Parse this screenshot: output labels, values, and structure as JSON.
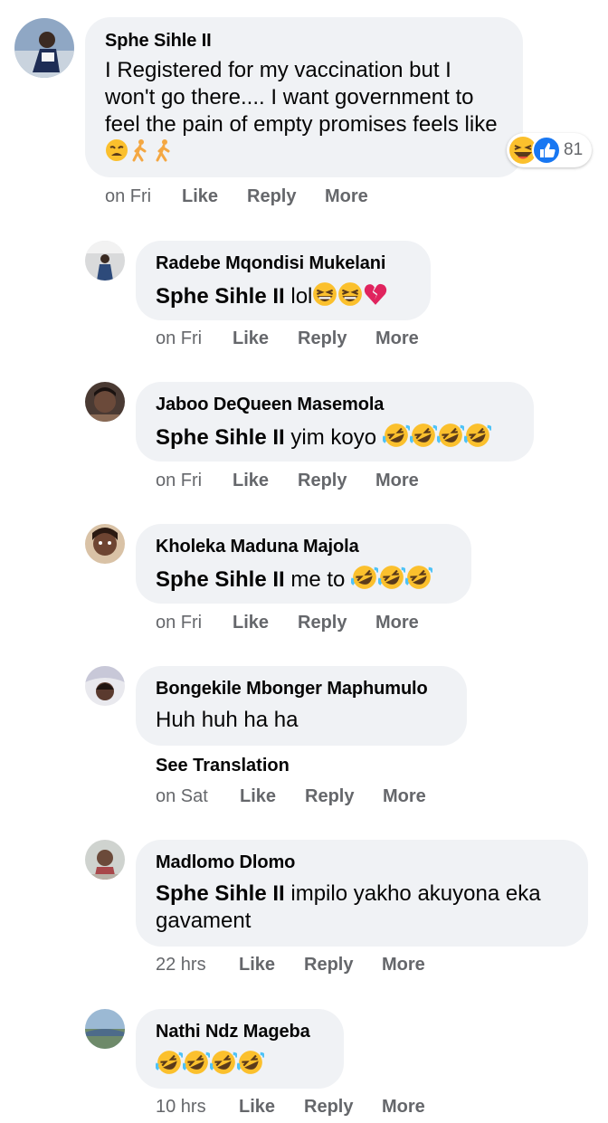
{
  "comments": [
    {
      "author": "Sphe Sihle II",
      "text": "I Registered for my vaccination but I won't go there.... I want government to feel the pain of empty promises feels like",
      "emoji_names": [
        "weary-face-icon",
        "person-walking-icon",
        "person-walking-icon"
      ],
      "reactions": {
        "count": "81",
        "icons": [
          "haha-reaction-icon",
          "like-reaction-icon"
        ]
      },
      "time": "on Fri",
      "like": "Like",
      "reply": "Reply",
      "more": "More"
    },
    {
      "author": "Radebe Mqondisi Mukelani",
      "mention": "Sphe Sihle II",
      "text": "lol",
      "emoji_names": [
        "grinning-squinting-face-icon",
        "grinning-squinting-face-icon",
        "broken-heart-icon"
      ],
      "time": "on Fri",
      "like": "Like",
      "reply": "Reply",
      "more": "More"
    },
    {
      "author": "Jaboo DeQueen Masemola",
      "mention": "Sphe Sihle II",
      "text": "yim koyo",
      "emoji_names": [
        "rolling-on-floor-laughing-icon",
        "rolling-on-floor-laughing-icon",
        "rolling-on-floor-laughing-icon",
        "rolling-on-floor-laughing-icon"
      ],
      "time": "on Fri",
      "like": "Like",
      "reply": "Reply",
      "more": "More"
    },
    {
      "author": "Kholeka Maduna Majola",
      "mention": "Sphe Sihle II",
      "text": "me to",
      "emoji_names": [
        "rolling-on-floor-laughing-icon",
        "rolling-on-floor-laughing-icon",
        "rolling-on-floor-laughing-icon"
      ],
      "time": "on Fri",
      "like": "Like",
      "reply": "Reply",
      "more": "More"
    },
    {
      "author": "Bongekile Mbonger Maphumulo",
      "text": "Huh huh ha ha",
      "see_translation": "See Translation",
      "time": "on Sat",
      "like": "Like",
      "reply": "Reply",
      "more": "More"
    },
    {
      "author": "Madlomo Dlomo",
      "mention": "Sphe Sihle II",
      "text": "impilo yakho akuyona eka",
      "text_line2": "gavament",
      "time": "22 hrs",
      "like": "Like",
      "reply": "Reply",
      "more": "More"
    },
    {
      "author": "Nathi Ndz Mageba",
      "emoji_names": [
        "rolling-on-floor-laughing-icon",
        "rolling-on-floor-laughing-icon",
        "rolling-on-floor-laughing-icon",
        "rolling-on-floor-laughing-icon"
      ],
      "time": "10 hrs",
      "like": "Like",
      "reply": "Reply",
      "more": "More"
    }
  ],
  "colors": {
    "bubble": "#f0f2f5",
    "meta_text": "#65676b",
    "like_blue": "#1877f2",
    "emoji_yellow": "#fbc02d"
  }
}
